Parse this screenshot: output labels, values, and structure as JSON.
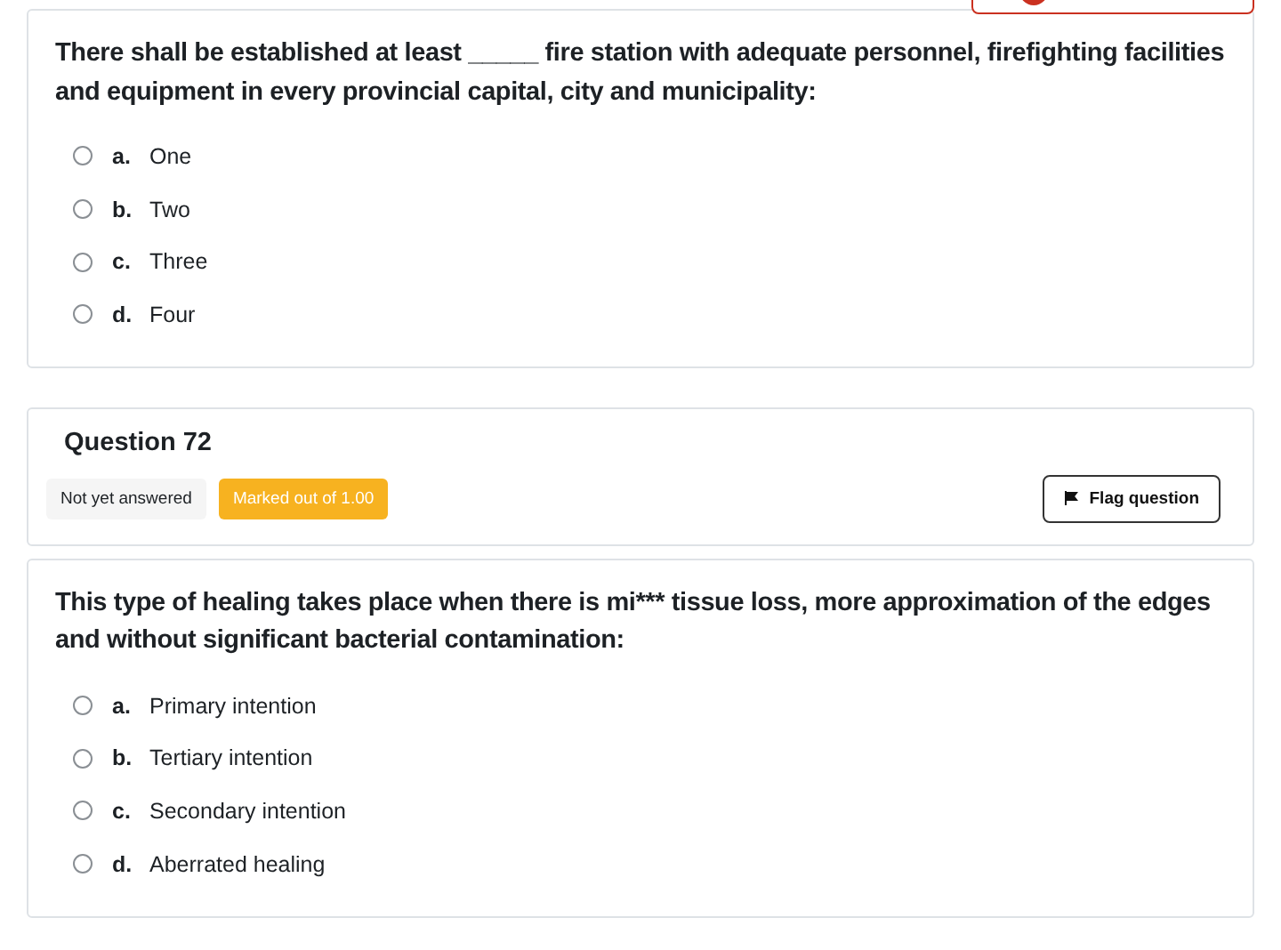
{
  "questions": [
    {
      "text": "There shall be established at least _____ fire station with adequate personnel, firefighting facilities and equipment in every provincial capital, city and municipality:",
      "options": [
        {
          "letter": "a.",
          "label": "One",
          "selected": false
        },
        {
          "letter": "b.",
          "label": "Two",
          "selected": false
        },
        {
          "letter": "c.",
          "label": "Three",
          "selected": false
        },
        {
          "letter": "d.",
          "label": "Four",
          "selected": false
        }
      ]
    },
    {
      "header": {
        "title": "Question 72",
        "status": "Not yet answered",
        "marks": "Marked out of 1.00",
        "flag_button": "Flag question"
      },
      "text": "This type of healing takes place when there is mi*** tissue loss, more approximation of the edges and without significant bacterial contamination:",
      "options": [
        {
          "letter": "a.",
          "label": "Primary intention",
          "selected": false
        },
        {
          "letter": "b.",
          "label": "Tertiary intention",
          "selected": false
        },
        {
          "letter": "c.",
          "label": "Secondary intention",
          "selected": false
        },
        {
          "letter": "d.",
          "label": "Aberrated healing",
          "selected": false
        }
      ]
    }
  ]
}
